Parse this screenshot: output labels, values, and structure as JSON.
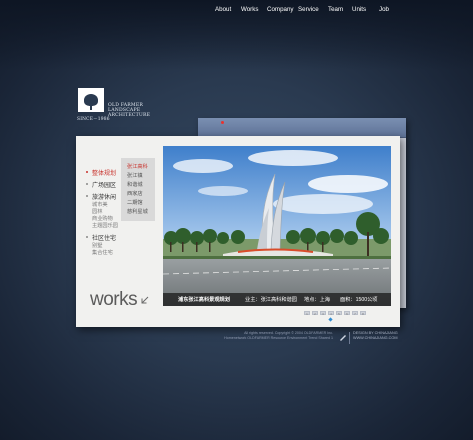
{
  "brand": {
    "line1": "OLD FARMER",
    "line2": "LANDSCAPE",
    "line3": "ARCHITECTURE",
    "since": "SINCE－1986"
  },
  "nav": {
    "items": [
      {
        "label": "About"
      },
      {
        "label": "Works"
      },
      {
        "label": "Company"
      },
      {
        "label": "Service"
      },
      {
        "label": "Team"
      },
      {
        "label": "Units"
      },
      {
        "label": "Job"
      }
    ]
  },
  "menu": {
    "items": [
      {
        "label": "整体规划"
      },
      {
        "label": "广场园区"
      },
      {
        "label": "旅游休闲"
      },
      {
        "label": "城市美"
      },
      {
        "label": "园林"
      },
      {
        "label": "商业购物"
      },
      {
        "label": "主题园乐园"
      },
      {
        "label": "社区住宅"
      },
      {
        "label": "别墅"
      },
      {
        "label": "集合住宅"
      }
    ],
    "submenu": [
      "张江高科",
      "张江镇",
      "和谐城",
      "西家店",
      "二期馆",
      "慈利星城"
    ]
  },
  "caption": {
    "title": "浦东张江高科景观规划",
    "owner": "业主：张江高科和谐园",
    "location": "地点：上海",
    "area": "面积：1500公顷"
  },
  "pager": {
    "pages": [
      "1",
      "2",
      "3",
      "4",
      "5",
      "6",
      "7",
      "8"
    ]
  },
  "section_title": "works",
  "footer": {
    "line1": "All rights reserved.    Copyright © 2004 OLDFARMER Inc.",
    "line2": "Homenetwork OLDFARMER Resource Environment Trend Shared 1",
    "design_by": "DESIGN BY CHINAJIANG",
    "site": "WWW.CHINAJIANG.COM"
  },
  "colors": {
    "accent_red": "#c8322c",
    "nav_blue": "#6b80a6",
    "indicator_blue": "#2f8bd1"
  }
}
